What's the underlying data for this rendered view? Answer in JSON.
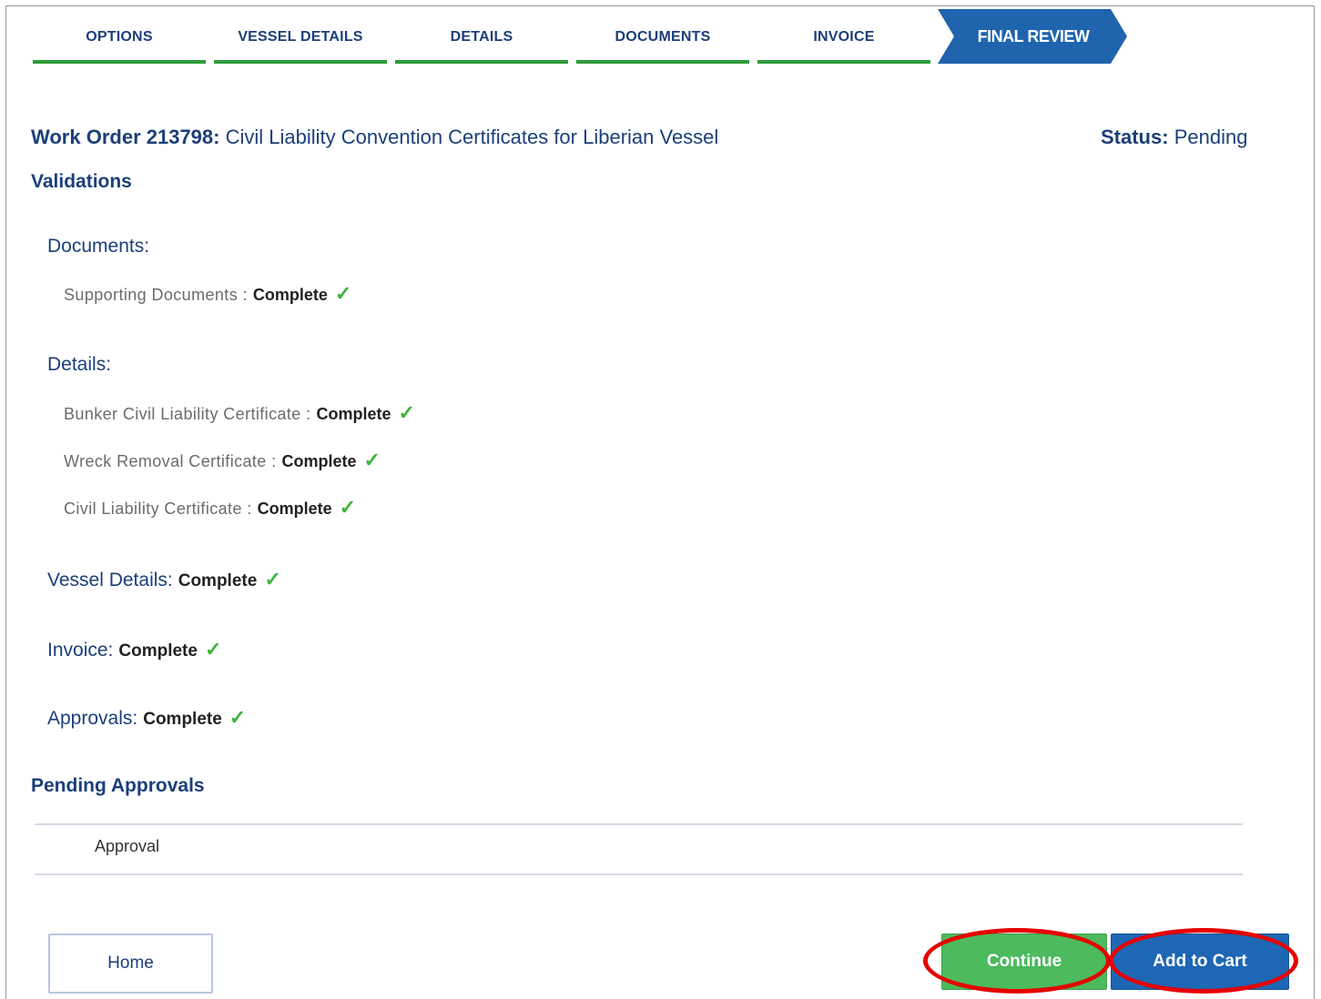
{
  "stepper": {
    "steps": [
      "OPTIONS",
      "VESSEL DETAILS",
      "DETAILS",
      "DOCUMENTS",
      "INVOICE"
    ],
    "active": "FINAL REVIEW",
    "colors": {
      "complete_bar": "#2e9b3a",
      "active_fill": "#1f64ad",
      "text": "#1c3f7a"
    }
  },
  "work_order": {
    "label": "Work Order 213798:",
    "title": "Civil Liability Convention Certificates for Liberian Vessel",
    "status_label": "Status:",
    "status_value": "Pending"
  },
  "validations": {
    "heading": "Validations",
    "documents": {
      "label": "Documents:",
      "items": [
        {
          "label": "Supporting Documents :",
          "value": "Complete"
        }
      ]
    },
    "details": {
      "label": "Details:",
      "items": [
        {
          "label": "Bunker Civil Liability Certificate :",
          "value": "Complete"
        },
        {
          "label": "Wreck Removal Certificate :",
          "value": "Complete"
        },
        {
          "label": "Civil Liability Certificate :",
          "value": "Complete"
        }
      ]
    },
    "vessel_details": {
      "label": "Vessel Details:",
      "value": "Complete"
    },
    "invoice": {
      "label": "Invoice:",
      "value": "Complete"
    },
    "approvals": {
      "label": "Approvals:",
      "value": "Complete"
    },
    "check_icon": "checkmark-icon"
  },
  "pending_approvals": {
    "heading": "Pending Approvals",
    "column_header": "Approval"
  },
  "buttons": {
    "home": "Home",
    "continue": "Continue",
    "add_to_cart": "Add to Cart"
  },
  "annotation_color": "#e60000"
}
